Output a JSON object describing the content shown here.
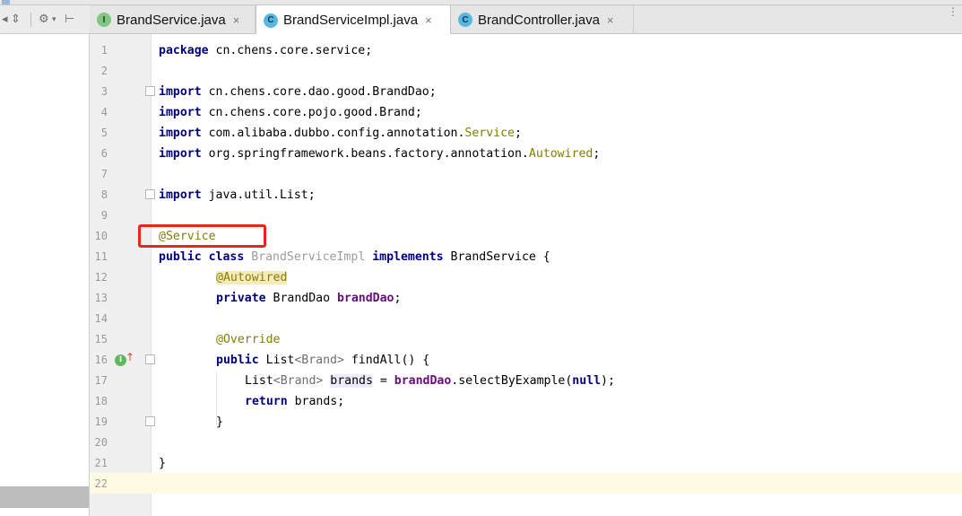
{
  "left_toolbar": {
    "collapse_icon": "collapse-all-icon",
    "settings_icon": "gear-icon",
    "settings_caret": "▾",
    "hide_icon": "hide-pane-icon"
  },
  "tabs": [
    {
      "label": "BrandService.java",
      "icon_letter": "I",
      "icon": "interface-icon",
      "close": "×"
    },
    {
      "label": "BrandServiceImpl.java",
      "icon_letter": "C",
      "icon": "class-icon",
      "close": "×"
    },
    {
      "label": "BrandController.java",
      "icon_letter": "C",
      "icon": "class-icon",
      "close": "×"
    }
  ],
  "gutter": {
    "line_numbers": [
      "1",
      "2",
      "3",
      "4",
      "5",
      "6",
      "7",
      "8",
      "9",
      "10",
      "11",
      "12",
      "13",
      "14",
      "15",
      "16",
      "17",
      "18",
      "19",
      "20",
      "21",
      "22"
    ],
    "implements_marker": "I",
    "override_arrow": "↑"
  },
  "code": {
    "l1": {
      "kw": "package",
      "rest": " cn.chens.core.service;"
    },
    "l3": {
      "kw": "import",
      "rest": " cn.chens.core.dao.good.BrandDao;"
    },
    "l4": {
      "kw": "import",
      "rest": " cn.chens.core.pojo.good.Brand;"
    },
    "l5": {
      "kw": "import",
      "pre": " com.alibaba.dubbo.config.annotation.",
      "ann": "Service",
      "post": ";"
    },
    "l6": {
      "kw": "import",
      "pre": " org.springframework.beans.factory.annotation.",
      "ann": "Autowired",
      "post": ";"
    },
    "l8": {
      "kw": "import",
      "rest": " java.util.List;"
    },
    "l10": {
      "ann": "@Service"
    },
    "l11": {
      "kw1": "public class",
      "name": " BrandServiceImpl ",
      "kw2": "implements",
      "rest": " BrandService {"
    },
    "l12": {
      "ann": "@Autowired"
    },
    "l13": {
      "kw": "private",
      "type": " BrandDao ",
      "field": "brandDao",
      "post": ";"
    },
    "l15": {
      "ann": "@Override"
    },
    "l16": {
      "kw": "public",
      "pre": " List",
      "gen": "<Brand>",
      "post": " findAll() {"
    },
    "l17": {
      "pre": "List",
      "gen": "<Brand>",
      "sp": " ",
      "var": "brands",
      "eq": " = ",
      "field": "brandDao",
      "call": ".selectByExample(",
      "kw": "null",
      "end": ");"
    },
    "l18": {
      "kw": "return",
      "rest": " brands;"
    },
    "l19": {
      "rest": "}"
    },
    "l21": {
      "rest": "}"
    }
  },
  "highlight": {
    "color": "#e8261f",
    "target": "@Service"
  },
  "colors": {
    "keyword": "#000080",
    "annotation": "#808000",
    "field": "#660e7a",
    "line_number": "#999999",
    "caret_row": "#fffae3"
  }
}
